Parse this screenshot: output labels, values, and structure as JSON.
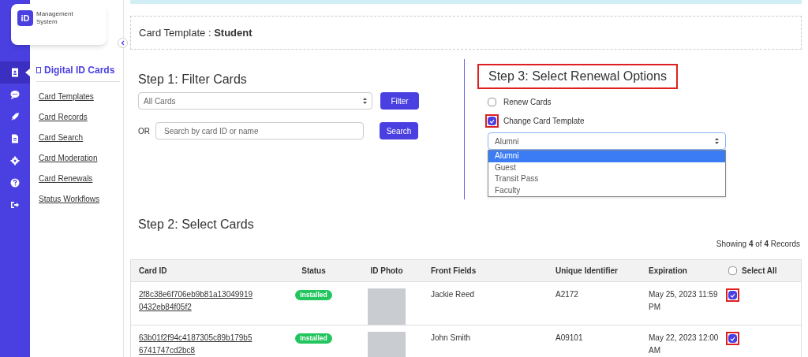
{
  "logo": {
    "mark": "iD",
    "text": "Management System"
  },
  "rail": [
    {
      "kind": "card",
      "selected": true
    },
    {
      "kind": "chat",
      "selected": false
    },
    {
      "kind": "rocket",
      "selected": false
    },
    {
      "kind": "document",
      "selected": false
    },
    {
      "kind": "gear",
      "selected": false
    },
    {
      "kind": "help",
      "selected": false
    },
    {
      "kind": "logout",
      "selected": false
    }
  ],
  "sidebar": {
    "title": "Digital ID Cards",
    "items": [
      "Card Templates",
      "Card Records",
      "Card Search",
      "Card Moderation",
      "Card Renewals",
      "Status Workflows"
    ]
  },
  "template_bar": {
    "label": "Card Template : ",
    "value": "Student"
  },
  "step1": {
    "title": "Step 1: Filter Cards",
    "filter_select": "All Cards",
    "filter_button": "Filter",
    "or_label": "OR",
    "search": {
      "placeholder": "Search by card ID or name"
    },
    "search_button": "Search"
  },
  "step3": {
    "title": "Step 3: Select Renewal Options",
    "highlighted": true,
    "options": [
      {
        "label": "Renew Cards",
        "checked": false,
        "highlighted": false
      },
      {
        "label": "Change Card Template",
        "checked": true,
        "highlighted": true
      }
    ],
    "template_select": "Alumni",
    "dropdown_options": [
      {
        "label": "Alumni",
        "selected": true
      },
      {
        "label": "Guest",
        "selected": false
      },
      {
        "label": "Transit Pass",
        "selected": false
      },
      {
        "label": "Faculty",
        "selected": false
      }
    ]
  },
  "step2": {
    "title": "Step 2: Select Cards",
    "showing": "Showing **4** of **4** Records"
  },
  "table": {
    "columns": [
      "Card ID",
      "Status",
      "ID Photo",
      "Front Fields",
      "Unique Identifier",
      "Expiration"
    ],
    "select_all": {
      "label": "Select All",
      "checked": false
    },
    "rows": [
      {
        "card_id": "2f8c38e6f706eb9b81a13049919 0432eb84f05f2",
        "status": "Installed",
        "front_fields": "Jackie Reed",
        "unique_identifier": "A2172",
        "expiration": "May 25, 2023 11:59 PM",
        "selected": true,
        "highlighted": true
      },
      {
        "card_id": "63b01f2f94c4187305c89b179b5 6741747cd2bc8",
        "status": "Installed",
        "front_fields": "John Smith",
        "unique_identifier": "A09101",
        "expiration": "May 22, 2023 12:00 AM",
        "selected": true,
        "highlighted": true
      }
    ]
  }
}
